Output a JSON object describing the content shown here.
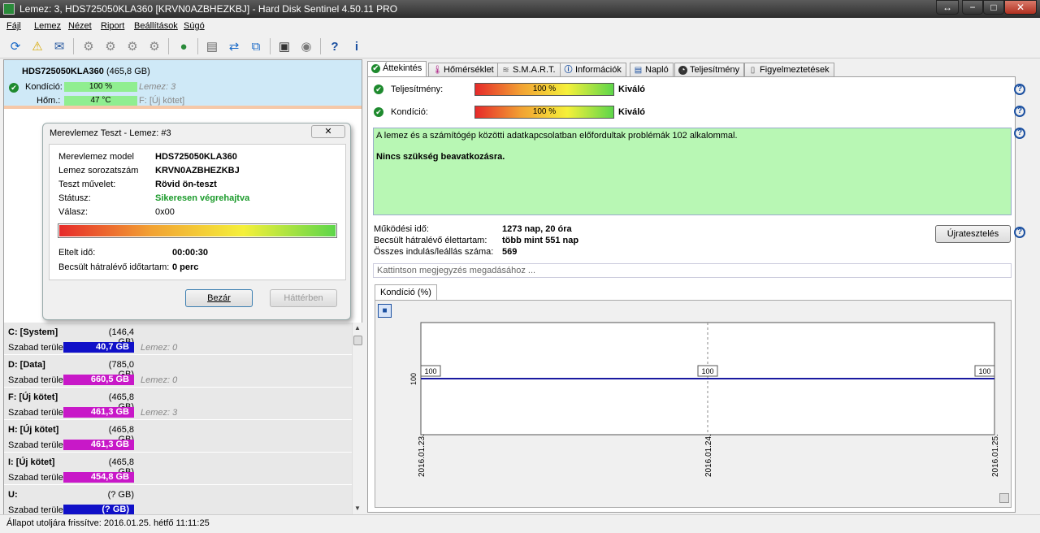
{
  "window": {
    "title": "Lemez: 3, HDS725050KLA360 [KRVN0AZBHEZKBJ]  -  Hard Disk Sentinel 4.50.11 PRO",
    "btn_resize": "↔",
    "btn_min": "−",
    "btn_max": "□",
    "btn_close": "✕"
  },
  "menu": [
    "Fájl",
    "Lemez",
    "Nézet",
    "Riport",
    "Beállítások",
    "Súgó"
  ],
  "disk": {
    "name": "HDS725050KLA360",
    "size": "(465,8 GB)",
    "kondicio_label": "Kondíció:",
    "kondicio_value": "100 %",
    "kondicio_pct": 100,
    "kondicio_note": "Lemez: 3",
    "hom_label": "Hőm.:",
    "hom_value": "47 °C",
    "hom_note": "F: [Új kötet]"
  },
  "dialog": {
    "title": "Merevlemez Teszt - Lemez: #3",
    "close": "✕",
    "rows": [
      {
        "label": "Merevlemez model",
        "value": "HDS725050KLA360"
      },
      {
        "label": "Lemez sorozatszám",
        "value": "KRVN0AZBHEZKBJ"
      },
      {
        "label": "Teszt művelet:",
        "value": "Rövid ön-teszt"
      },
      {
        "label": "Státusz:",
        "value": "Sikeresen végrehajtva"
      },
      {
        "label": "Válasz:",
        "value": "0x00"
      }
    ],
    "progress_pct": 100,
    "elapsed_label": "Eltelt idő:",
    "elapsed_value": "00:00:30",
    "remaining_label": "Becsült hátralévő időtartam:",
    "remaining_value": "0 perc",
    "btn_close": "Bezár",
    "btn_background": "Háttérben"
  },
  "volumes": [
    {
      "name": "C: [System]",
      "size": "(146,4 GB)",
      "free_label": "Szabad terület",
      "free": "40,7 GB",
      "color": "#1010c8",
      "disk": "Lemez: 0"
    },
    {
      "name": "D: [Data]",
      "size": "(785,0 GB)",
      "free_label": "Szabad terület",
      "free": "660,5 GB",
      "color": "#c818c8",
      "disk": "Lemez: 0"
    },
    {
      "name": "F: [Új kötet]",
      "size": "(465,8 GB)",
      "free_label": "Szabad terület",
      "free": "461,3 GB",
      "color": "#c818c8",
      "disk": "Lemez: 3"
    },
    {
      "name": "H: [Új kötet]",
      "size": "(465,8 GB)",
      "free_label": "Szabad terület",
      "free": "461,3 GB",
      "color": "#c818c8",
      "disk": ""
    },
    {
      "name": "I: [Új kötet]",
      "size": "(465,8 GB)",
      "free_label": "Szabad terület",
      "free": "454,8 GB",
      "color": "#c818c8",
      "disk": ""
    },
    {
      "name": "U:",
      "size": "(? GB)",
      "free_label": "Szabad terület",
      "free": "(? GB)",
      "color": "#1010c8",
      "disk": ""
    }
  ],
  "status": "Állapot utoljára frissítve: 2016.01.25. hétfő 11:11:25",
  "tabs": [
    "Áttekintés",
    "Hőmérséklet",
    "S.M.A.R.T.",
    "Információk",
    "Napló",
    "Teljesítmény",
    "Figyelmeztetések"
  ],
  "overview": {
    "perf_label": "Teljesítmény:",
    "perf_value": "100 %",
    "perf_rating": "Kiváló",
    "cond_label": "Kondíció:",
    "cond_value": "100 %",
    "cond_rating": "Kiváló",
    "message1": "A lemez és a számítógép közötti adatkapcsolatban előfordultak problémák 102 alkalommal.",
    "message2": "Nincs szükség beavatkozásra.",
    "uptime_label": "Működési idő:",
    "uptime_value": "1273 nap, 20 óra",
    "life_label": "Becsült hátralévő élettartam:",
    "life_value": "több mint 551 nap",
    "starts_label": "Összes indulás/leállás száma:",
    "starts_value": "569",
    "retest": "Újratesztelés",
    "note_placeholder": "Kattintson megjegyzés megadásához ...",
    "chart_tab": "Kondíció  (%)"
  },
  "chart_data": {
    "type": "line",
    "x": [
      "2016.01.23.",
      "2016.01.24.",
      "2016.01.25."
    ],
    "series": [
      {
        "values": [
          100,
          100,
          100
        ]
      }
    ],
    "ylabel": "100",
    "color": "#1a1aa0"
  }
}
